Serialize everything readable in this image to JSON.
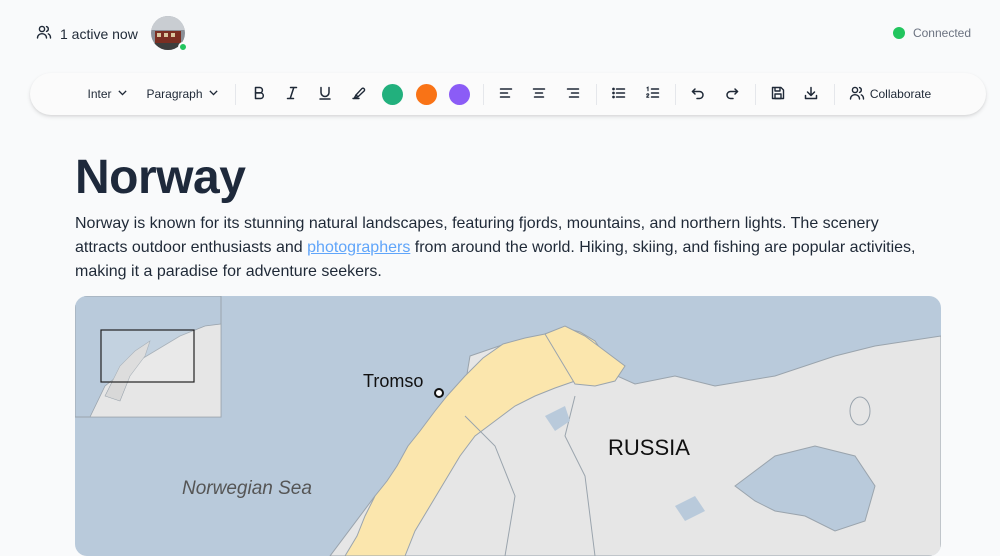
{
  "presence": {
    "active_text": "1 active now",
    "avatar_status_color": "#22c55e"
  },
  "connection": {
    "status": "Connected",
    "color": "#22c55e"
  },
  "toolbar": {
    "font": "Inter",
    "block_type": "Paragraph",
    "colors": [
      "#22b07d",
      "#f97316",
      "#8b5cf6"
    ],
    "collaborate_label": "Collaborate"
  },
  "document": {
    "title": "Norway",
    "para_before_link": "Norway is known for its stunning natural landscapes, featuring fjords, mountains, and northern lights. The scenery attracts outdoor enthusiasts and ",
    "link_text": "photographers",
    "para_after_link": " from around the world. Hiking, skiing, and fishing are popular activities, making it a paradise for adventure seekers."
  },
  "map": {
    "labels": {
      "city": "Tromso",
      "country": "RUSSIA",
      "sea": "Norwegian Sea"
    },
    "colors": {
      "sea": "#b9cadb",
      "norway": "#fbe6ad",
      "land": "#e6e6e6"
    }
  }
}
